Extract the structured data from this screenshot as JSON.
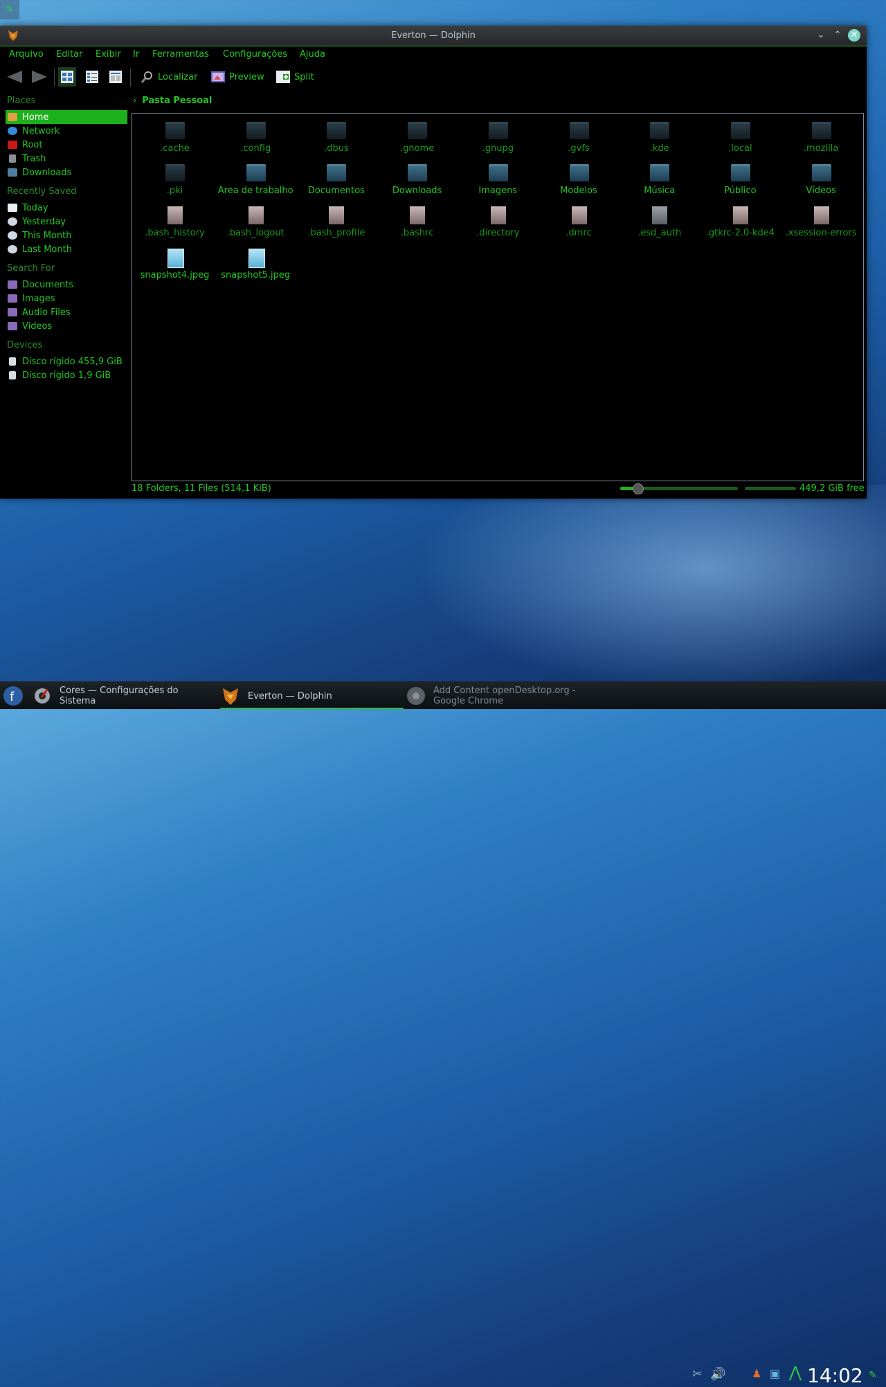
{
  "desktop": {
    "corner_icon": "wrench-icon"
  },
  "window": {
    "title": "Everton — Dolphin",
    "menu": [
      "Arquivo",
      "Editar",
      "Exibir",
      "Ir",
      "Ferramentas",
      "Configurações",
      "Ajuda"
    ],
    "toolbar": {
      "find": "Localizar",
      "preview": "Preview",
      "split": "Split"
    }
  },
  "sidebar": {
    "places_title": "Places",
    "places": [
      "Home",
      "Network",
      "Root",
      "Trash",
      "Downloads"
    ],
    "recent_title": "Recently Saved",
    "recent": [
      "Today",
      "Yesterday",
      "This Month",
      "Last Month"
    ],
    "search_title": "Search For",
    "search": [
      "Documents",
      "Images",
      "Audio Files",
      "Videos"
    ],
    "devices_title": "Devices",
    "devices": [
      "Disco rígido 455,9 GiB",
      "Disco rígido 1,9 GiB"
    ]
  },
  "breadcrumb": "Pasta Pessoal",
  "files": [
    {
      "name": ".cache",
      "type": "folder-hidden"
    },
    {
      "name": ".config",
      "type": "folder-hidden"
    },
    {
      "name": ".dbus",
      "type": "folder-hidden"
    },
    {
      "name": ".gnome",
      "type": "folder-hidden"
    },
    {
      "name": ".gnupg",
      "type": "folder-hidden"
    },
    {
      "name": ".gvfs",
      "type": "folder-hidden"
    },
    {
      "name": ".kde",
      "type": "folder-hidden"
    },
    {
      "name": ".local",
      "type": "folder-hidden"
    },
    {
      "name": ".mozilla",
      "type": "folder-hidden"
    },
    {
      "name": ".pki",
      "type": "folder-hidden"
    },
    {
      "name": "Área de trabalho",
      "type": "folder"
    },
    {
      "name": "Documentos",
      "type": "folder"
    },
    {
      "name": "Downloads",
      "type": "folder"
    },
    {
      "name": "Imagens",
      "type": "folder"
    },
    {
      "name": "Modelos",
      "type": "folder"
    },
    {
      "name": "Música",
      "type": "folder"
    },
    {
      "name": "Público",
      "type": "folder"
    },
    {
      "name": "Vídeos",
      "type": "folder"
    },
    {
      "name": ".bash_history",
      "type": "doc"
    },
    {
      "name": ".bash_logout",
      "type": "doc"
    },
    {
      "name": ".bash_profile",
      "type": "doc"
    },
    {
      "name": ".bashrc",
      "type": "doc"
    },
    {
      "name": ".directory",
      "type": "doc"
    },
    {
      "name": ".dmrc",
      "type": "doc"
    },
    {
      "name": ".esd_auth",
      "type": "binary"
    },
    {
      "name": ".gtkrc-2.0-kde4",
      "type": "doc"
    },
    {
      "name": ".xsession-errors",
      "type": "doc"
    },
    {
      "name": "snapshot4.jpeg",
      "type": "image"
    },
    {
      "name": "snapshot5.jpeg",
      "type": "image"
    }
  ],
  "status": {
    "summary": "18 Folders, 11 Files (514,1 KiB)",
    "free": "449,2 GiB free"
  },
  "taskbar": {
    "tasks": [
      "Cores  — Configurações do Sistema",
      "Everton — Dolphin",
      "Add  Content openDesktop.org - Google Chrome"
    ],
    "clock": "14:02"
  }
}
